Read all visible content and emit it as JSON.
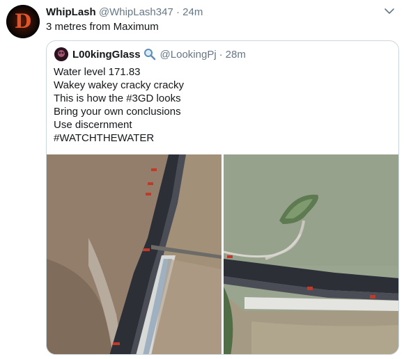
{
  "tweet": {
    "name": "WhipLash",
    "handle": "@WhipLash347",
    "separator": "·",
    "time": "24m",
    "avatar_letter": "D",
    "text": "3 metres from Maximum"
  },
  "quoted": {
    "name": "L00kingGlass",
    "handle": "@LookingPj",
    "separator": "·",
    "time": "28m",
    "lines": [
      "Water level 171.83",
      "Wakey wakey cracky cracky",
      "This is how the #3GD looks",
      "Bring your own conclusions",
      "Use discernment",
      "#WATCHTHEWATER"
    ],
    "icon": "magnifying-glass-icon"
  },
  "colors": {
    "text": "#14171a",
    "secondary": "#657786",
    "border": "#ccd6dd",
    "avatar_glyph": "#e0542a",
    "water_left": "#8e7a68",
    "water_right": "#9aa58f"
  }
}
